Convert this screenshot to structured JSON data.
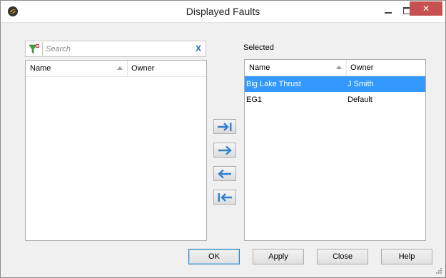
{
  "window": {
    "title": "Displayed Faults",
    "close_glyph": "✕"
  },
  "search": {
    "placeholder": "Search",
    "clear_label": "X"
  },
  "available_list": {
    "columns": [
      "Name",
      "Owner"
    ],
    "rows": []
  },
  "selected_list": {
    "label": "Selected",
    "columns": [
      "Name",
      "Owner"
    ],
    "rows": [
      {
        "name": "Big Lake Thrust",
        "owner": "J Smith",
        "selected": true
      },
      {
        "name": "EG1",
        "owner": "Default",
        "selected": false
      }
    ]
  },
  "transfer_buttons": [
    {
      "icon": "arrow-right-to-bar-icon"
    },
    {
      "icon": "arrow-right-icon"
    },
    {
      "icon": "arrow-left-icon"
    },
    {
      "icon": "arrow-left-to-bar-icon"
    }
  ],
  "buttons": {
    "ok": "OK",
    "apply": "Apply",
    "close": "Close",
    "help": "Help"
  },
  "colors": {
    "selection": "#3399ff",
    "arrow_blue": "#2f7fd0",
    "close_red": "#c75050"
  }
}
